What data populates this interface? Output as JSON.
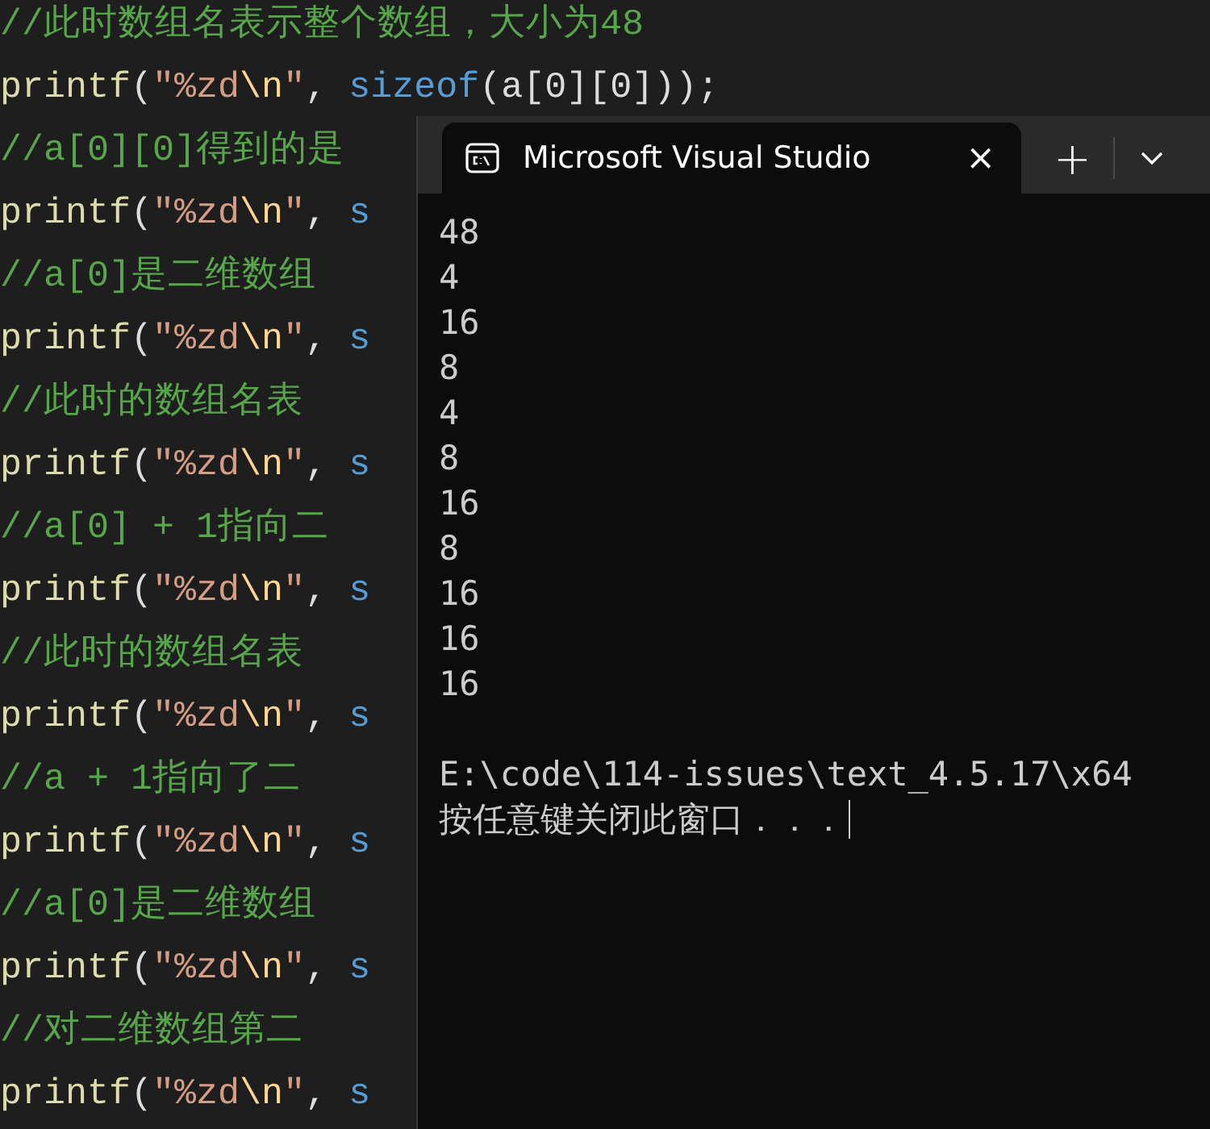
{
  "editor": {
    "lines": [
      {
        "segments": [
          {
            "text": "//此时数组名表示整个数组，大小为48",
            "kind": "comment"
          }
        ]
      },
      {
        "segments": [
          {
            "text": "printf",
            "kind": "func"
          },
          {
            "text": "(",
            "kind": "plain"
          },
          {
            "text": "\"%zd",
            "kind": "string"
          },
          {
            "text": "\\n",
            "kind": "escape"
          },
          {
            "text": "\"",
            "kind": "string"
          },
          {
            "text": ", ",
            "kind": "plain"
          },
          {
            "text": "sizeof",
            "kind": "keyword"
          },
          {
            "text": "(a[0][0]));",
            "kind": "plain"
          }
        ]
      },
      {
        "segments": [
          {
            "text": "//a[0][0]得到的是",
            "kind": "comment"
          }
        ]
      },
      {
        "segments": [
          {
            "text": "printf",
            "kind": "func"
          },
          {
            "text": "(",
            "kind": "plain"
          },
          {
            "text": "\"%zd",
            "kind": "string"
          },
          {
            "text": "\\n",
            "kind": "escape"
          },
          {
            "text": "\"",
            "kind": "string"
          },
          {
            "text": ", ",
            "kind": "plain"
          },
          {
            "text": "s",
            "kind": "keyword"
          }
        ]
      },
      {
        "segments": [
          {
            "text": "//a[0]是二维数组",
            "kind": "comment"
          }
        ]
      },
      {
        "segments": [
          {
            "text": "printf",
            "kind": "func"
          },
          {
            "text": "(",
            "kind": "plain"
          },
          {
            "text": "\"%zd",
            "kind": "string"
          },
          {
            "text": "\\n",
            "kind": "escape"
          },
          {
            "text": "\"",
            "kind": "string"
          },
          {
            "text": ", ",
            "kind": "plain"
          },
          {
            "text": "s",
            "kind": "keyword"
          }
        ]
      },
      {
        "segments": [
          {
            "text": "//此时的数组名表",
            "kind": "comment"
          }
        ]
      },
      {
        "segments": [
          {
            "text": "printf",
            "kind": "func"
          },
          {
            "text": "(",
            "kind": "plain"
          },
          {
            "text": "\"%zd",
            "kind": "string"
          },
          {
            "text": "\\n",
            "kind": "escape"
          },
          {
            "text": "\"",
            "kind": "string"
          },
          {
            "text": ", ",
            "kind": "plain"
          },
          {
            "text": "s",
            "kind": "keyword"
          }
        ]
      },
      {
        "segments": [
          {
            "text": "//a[0] + 1指向二",
            "kind": "comment"
          }
        ]
      },
      {
        "segments": [
          {
            "text": "printf",
            "kind": "func"
          },
          {
            "text": "(",
            "kind": "plain"
          },
          {
            "text": "\"%zd",
            "kind": "string"
          },
          {
            "text": "\\n",
            "kind": "escape"
          },
          {
            "text": "\"",
            "kind": "string"
          },
          {
            "text": ", ",
            "kind": "plain"
          },
          {
            "text": "s",
            "kind": "keyword"
          }
        ]
      },
      {
        "segments": [
          {
            "text": "//此时的数组名表",
            "kind": "comment"
          }
        ]
      },
      {
        "segments": [
          {
            "text": "printf",
            "kind": "func"
          },
          {
            "text": "(",
            "kind": "plain"
          },
          {
            "text": "\"%zd",
            "kind": "string"
          },
          {
            "text": "\\n",
            "kind": "escape"
          },
          {
            "text": "\"",
            "kind": "string"
          },
          {
            "text": ", ",
            "kind": "plain"
          },
          {
            "text": "s",
            "kind": "keyword"
          }
        ]
      },
      {
        "segments": [
          {
            "text": "//a + 1指向了二",
            "kind": "comment"
          }
        ]
      },
      {
        "segments": [
          {
            "text": "printf",
            "kind": "func"
          },
          {
            "text": "(",
            "kind": "plain"
          },
          {
            "text": "\"%zd",
            "kind": "string"
          },
          {
            "text": "\\n",
            "kind": "escape"
          },
          {
            "text": "\"",
            "kind": "string"
          },
          {
            "text": ", ",
            "kind": "plain"
          },
          {
            "text": "s",
            "kind": "keyword"
          }
        ]
      },
      {
        "segments": [
          {
            "text": "//a[0]是二维数组",
            "kind": "comment"
          }
        ]
      },
      {
        "segments": [
          {
            "text": "printf",
            "kind": "func"
          },
          {
            "text": "(",
            "kind": "plain"
          },
          {
            "text": "\"%zd",
            "kind": "string"
          },
          {
            "text": "\\n",
            "kind": "escape"
          },
          {
            "text": "\"",
            "kind": "string"
          },
          {
            "text": ", ",
            "kind": "plain"
          },
          {
            "text": "s",
            "kind": "keyword"
          }
        ]
      },
      {
        "segments": [
          {
            "text": "//对二维数组第二",
            "kind": "comment"
          }
        ]
      },
      {
        "segments": [
          {
            "text": "printf",
            "kind": "func"
          },
          {
            "text": "(",
            "kind": "plain"
          },
          {
            "text": "\"%zd",
            "kind": "string"
          },
          {
            "text": "\\n",
            "kind": "escape"
          },
          {
            "text": "\"",
            "kind": "string"
          },
          {
            "text": ", ",
            "kind": "plain"
          },
          {
            "text": "s",
            "kind": "keyword"
          }
        ]
      }
    ]
  },
  "terminal": {
    "tab": {
      "title": "Microsoft Visual Studio",
      "selected": true,
      "close": "×"
    },
    "new_tab": "+",
    "output": [
      "48",
      "4",
      "16",
      "8",
      "4",
      "8",
      "16",
      "8",
      "16",
      "16",
      "16"
    ],
    "path": "E:\\code\\114-issues\\text_4.5.17\\x64",
    "prompt": "按任意键关闭此窗口．．．"
  }
}
